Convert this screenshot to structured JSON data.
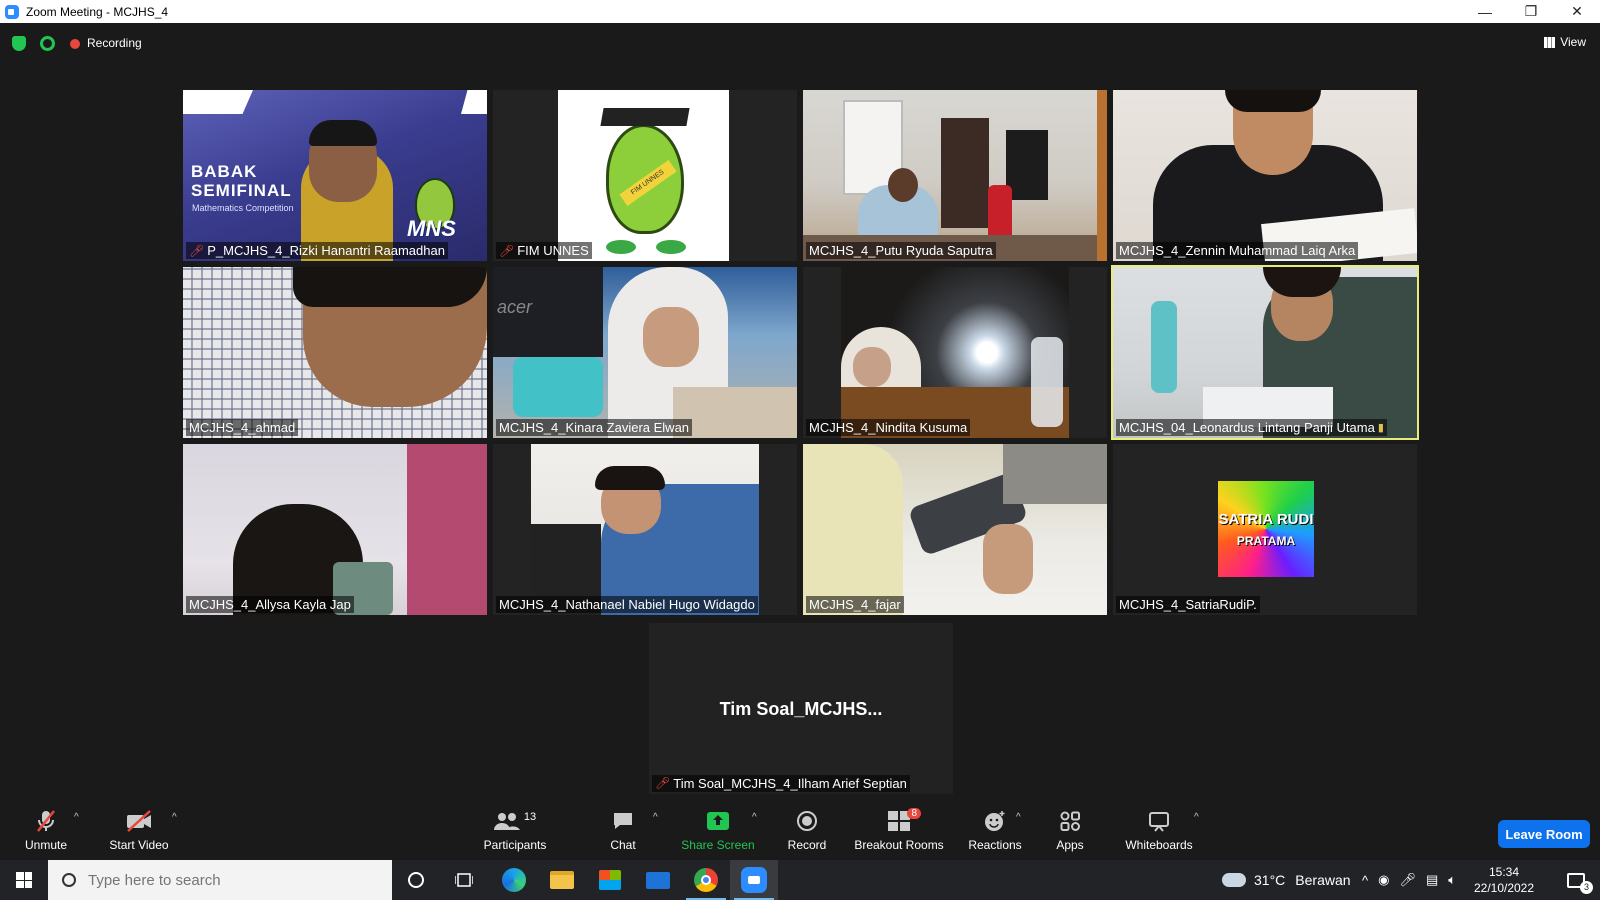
{
  "window": {
    "title": "Zoom Meeting - MCJHS_4"
  },
  "meeting_bar": {
    "recording_label": "Recording",
    "view_label": "View"
  },
  "tiles": [
    {
      "name": "P_MCJHS_4_Rizki Hanantri Raamadhan",
      "muted": true,
      "banner_title": "BABAK",
      "banner_title2": "SEMIFINAL",
      "banner_sub": "Mathematics Competition",
      "banner_logo": "MNS"
    },
    {
      "name": "FIM UNNES",
      "muted": true,
      "mascot_sash": "FIM UNNES"
    },
    {
      "name": "MCJHS_4_Putu Ryuda Saputra",
      "muted": false
    },
    {
      "name": "MCJHS_4_Zennin Muhammad Laiq Arka",
      "muted": false
    },
    {
      "name": "MCJHS_4_ahmad",
      "muted": false
    },
    {
      "name": "MCJHS_4_Kinara Zaviera Elwan",
      "muted": false,
      "monitor_brand": "acer"
    },
    {
      "name": "MCJHS_4_Nindita Kusuma",
      "muted": false
    },
    {
      "name": "MCJHS_04_Leonardus Lintang Panji Utama",
      "muted": false,
      "active_speaker": true
    },
    {
      "name": "MCJHS_4_Allysa Kayla Jap",
      "muted": false
    },
    {
      "name": "MCJHS_4_Nathanael Nabiel Hugo Widagdo",
      "muted": false
    },
    {
      "name": "MCJHS_4_fajar",
      "muted": false
    },
    {
      "name": "MCJHS_4_SatriaRudiP.",
      "muted": false,
      "avatar_line1": "SATRIA RUDI",
      "avatar_line2": "PRATAMA"
    }
  ],
  "spotlight": {
    "display_name": "Tim  Soal_MCJHS...",
    "name": "Tim Soal_MCJHS_4_Ilham Arief Septian",
    "muted": true
  },
  "toolbar": {
    "unmute": "Unmute",
    "start_video": "Start Video",
    "participants": "Participants",
    "participants_count": "13",
    "chat": "Chat",
    "share_screen": "Share Screen",
    "record": "Record",
    "breakout_rooms": "Breakout Rooms",
    "breakout_badge": "8",
    "reactions": "Reactions",
    "apps": "Apps",
    "whiteboards": "Whiteboards",
    "leave": "Leave Room"
  },
  "taskbar": {
    "search_placeholder": "Type here to search",
    "weather_temp": "31°C",
    "weather_text": "Berawan",
    "time": "15:34",
    "date": "22/10/2022",
    "notification_count": "3"
  },
  "colors": {
    "accent": "#0e72ed",
    "share_green": "#23c552",
    "mute_red": "#e8473b",
    "active_outline": "#e7ec7b"
  }
}
